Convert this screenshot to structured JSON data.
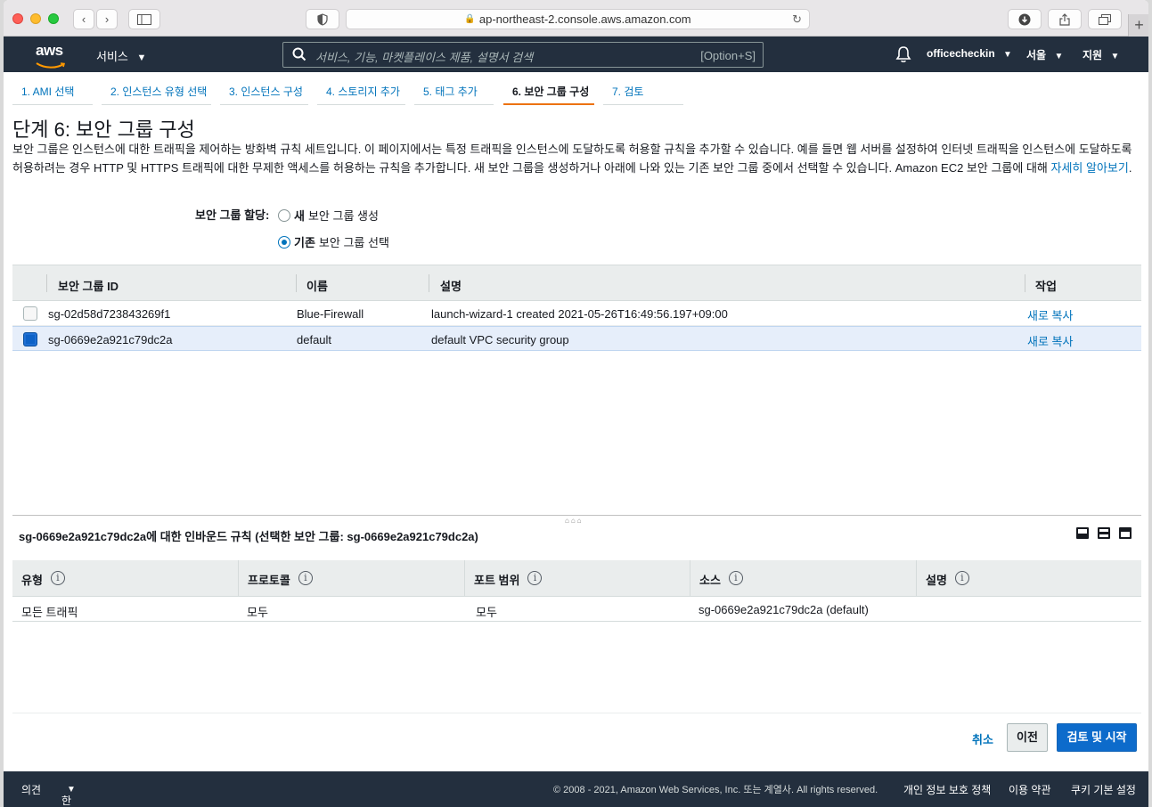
{
  "browser": {
    "url": "ap-northeast-2.console.aws.amazon.com"
  },
  "nav": {
    "logo_text": "aws",
    "services_label": "서비스",
    "search_placeholder": "서비스, 기능, 마켓플레이스 제품, 설명서 검색",
    "search_shortcut": "[Option+S]",
    "account": "officecheckin",
    "region": "서울",
    "support": "지원"
  },
  "wizard": {
    "tabs": [
      {
        "label": "1. AMI 선택"
      },
      {
        "label": "2. 인스턴스 유형 선택"
      },
      {
        "label": "3. 인스턴스 구성"
      },
      {
        "label": "4. 스토리지 추가"
      },
      {
        "label": "5. 태그 추가"
      },
      {
        "label": "6. 보안 그룹 구성"
      },
      {
        "label": "7. 검토"
      }
    ],
    "active_tab": 5
  },
  "page": {
    "title": "단계 6: 보안 그룹 구성",
    "description": "보안 그룹은 인스턴스에 대한 트래픽을 제어하는 방화벽 규칙 세트입니다. 이 페이지에서는 특정 트래픽을 인스턴스에 도달하도록 허용할 규칙을 추가할 수 있습니다. 예를 들면 웹 서버를 설정하여 인터넷 트래픽을 인스턴스에 도달하도록 허용하려는 경우 HTTP 및 HTTPS 트래픽에 대한 무제한 액세스를 허용하는 규칙을 추가합니다. 새 보안 그룹을 생성하거나 아래에 나와 있는 기존 보안 그룹 중에서 선택할 수 있습니다. Amazon EC2 보안 그룹에 대해 ",
    "learn_more": "자세히 알아보기",
    "desc_end": "."
  },
  "assign": {
    "label": "보안 그룹 할당:",
    "option_new_bold": "새",
    "option_new_rest": "보안 그룹 생성",
    "option_existing_bold": "기존",
    "option_existing_rest": "보안 그룹 선택",
    "selected": "existing"
  },
  "sg_table": {
    "headers": {
      "id": "보안 그룹 ID",
      "name": "이름",
      "desc": "설명",
      "action": "작업"
    },
    "rows": [
      {
        "id": "sg-02d58d723843269f1",
        "name": "Blue-Firewall",
        "desc": "launch-wizard-1 created 2021-05-26T16:49:56.197+09:00",
        "action": "새로 복사",
        "selected": false
      },
      {
        "id": "sg-0669e2a921c79dc2a",
        "name": "default",
        "desc": "default VPC security group",
        "action": "새로 복사",
        "selected": true
      }
    ]
  },
  "inbound": {
    "title": "sg-0669e2a921c79dc2a에 대한 인바운드 규칙 (선택한 보안 그룹: sg-0669e2a921c79dc2a)",
    "headers": [
      "유형",
      "프로토콜",
      "포트 범위",
      "소스",
      "설명"
    ],
    "rows": [
      {
        "type": "모든 트래픽",
        "protocol": "모두",
        "port": "모두",
        "source": "sg-0669e2a921c79dc2a (default)",
        "desc": ""
      }
    ]
  },
  "actions": {
    "cancel": "취소",
    "previous": "이전",
    "review_launch": "검토 및 시작"
  },
  "footer": {
    "feedback": "의견",
    "language": "한국어",
    "copyright": "© 2008 - 2021, Amazon Web Services, Inc. 또는 계열사. All rights reserved.",
    "privacy": "개인 정보 보호 정책",
    "terms": "이용 약관",
    "cookies": "쿠키 기본 설정"
  },
  "colors": {
    "nav_bg": "#232f3e",
    "link": "#0073bb",
    "active_tab_underline": "#ec7211",
    "primary_button": "#0d6bcb",
    "selected_row": "#e6eefa"
  }
}
